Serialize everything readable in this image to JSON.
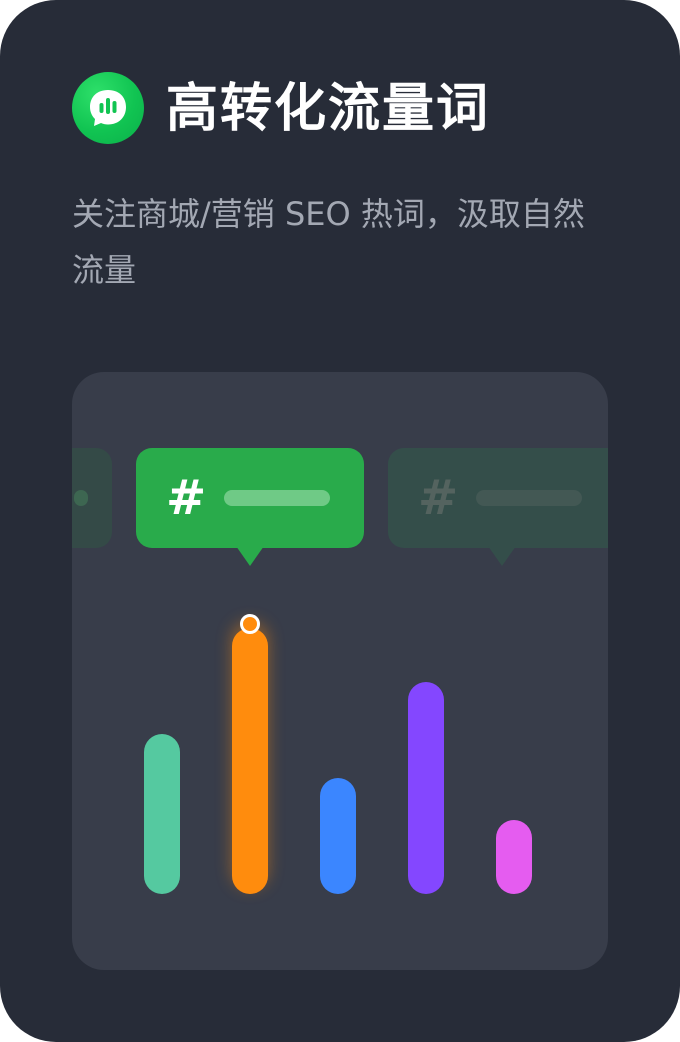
{
  "card": {
    "title": "高转化流量词",
    "subtitle": "关注商城/营销 SEO 热词，汲取自然流量",
    "icon": "chat-bars-icon"
  },
  "tags": {
    "prev": {
      "icon": "hash-icon"
    },
    "active": {
      "symbol": "#",
      "icon": "hash-icon"
    },
    "next": {
      "symbol": "#",
      "icon": "hash-icon"
    }
  },
  "colors": {
    "background": "#272c38",
    "panel": "#383d4a",
    "brand_green": "#11c452",
    "tag_active": "#29ab4b",
    "bars": [
      "#55c9a0",
      "#ff8c0d",
      "#3b86ff",
      "#8447ff",
      "#e55cf0"
    ]
  },
  "chart_data": {
    "type": "bar",
    "categories": [
      "",
      "",
      "",
      "",
      ""
    ],
    "values": [
      160,
      266,
      116,
      212,
      74
    ],
    "highlighted_index": 1,
    "xlabel": "",
    "ylabel": "",
    "grid": false
  }
}
